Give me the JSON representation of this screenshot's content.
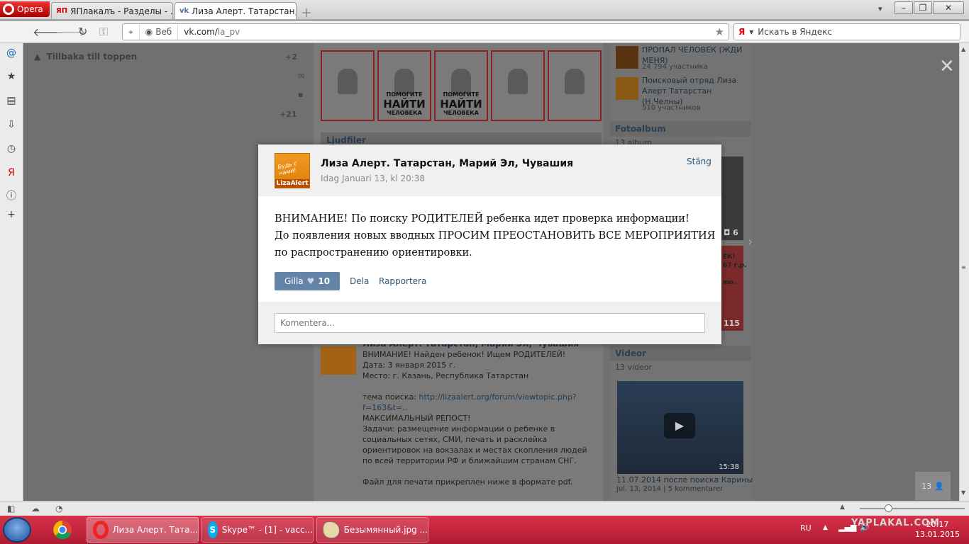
{
  "browser": {
    "name": "Opera",
    "tabs": [
      {
        "label": "ЯПлакалъ - Разделы - ...",
        "favicon": "ЯП",
        "active": false
      },
      {
        "label": "Лиза Алерт. Татарстан, ...",
        "favicon": "vk",
        "active": true
      }
    ],
    "address": {
      "mode_label": "Веб",
      "url_host": "vk.com/",
      "url_path": "la_pv"
    },
    "search": {
      "engine": "Я",
      "placeholder": "Искать в Яндекс"
    }
  },
  "page": {
    "back_to_top": "Tillbaka till toppen",
    "left_counts": {
      "friends": "+2",
      "other": "+21"
    },
    "posters": [
      {
        "help_line1": "",
        "help_line2": ""
      },
      {
        "help_line1": "ПОМОГИТЕ",
        "help_line2": "НАЙТИ"
      },
      {
        "help_line1": "ПОМОГИТЕ",
        "help_line2": "НАЙТИ"
      },
      {
        "help_line1": "",
        "help_line2": ""
      },
      {
        "help_line1": "",
        "help_line2": ""
      }
    ],
    "poster_help_bottom": "ЧЕЛОВЕКА",
    "audio_section": "Ljudfiler",
    "groups": [
      {
        "name": "ПРОПАЛ ЧЕЛОВЕК (ЖДИ МЕНЯ)",
        "members": "24 794 участника"
      },
      {
        "name": "Поисковый отряд Лиза Алерт Татарстан (Н.Челны)",
        "members": "510 участников"
      }
    ],
    "photo_album": {
      "title": "Fotoalbum",
      "count": "13 album",
      "photos_badge": "6",
      "album_badge": "115"
    },
    "poster_fragment": {
      "line1": "ЕК!",
      "line2": "67 г.р.",
      "line3": "ию."
    },
    "videos": {
      "title": "Videor",
      "count": "13 videor",
      "duration": "15:38",
      "caption": "11.07.2014 после поиска Карины",
      "meta_date": "Jul. 13, 2014",
      "meta_comments": "5 kommentarer"
    },
    "bg_post": {
      "author": "Лиза Алерт. Татарстан, Марий Эл, Чувашия",
      "lines": "ВНИМАНИЕ! Найден ребенок! Ищем РОДИТЕЛЕЙ!\nДата: 3 января 2015 г.\nМесто: г. Казань, Республика Татарстан\n\nтема поиска: ",
      "link": "http://lizaalert.org/forum/viewtopic.php?f=163&t=..",
      "rest": "\nМАКСИМАЛЬНЫЙ РЕПОСТ!\nЗадачи: размещение информации о ребенке в социальных сетях, СМИ, печать и расклейка ориентировок на вокзалах и местах скопления людей по всей территории РФ и ближайшим странам СНГ.\n\nФайл для печати прикреплен ниже в формате pdf."
    },
    "people_counter": "13"
  },
  "modal": {
    "logo_text": "LizaAlert",
    "logo_slogan": "Будь с нами!",
    "title": "Лиза Алерт. Татарстан, Марий Эл, Чувашия",
    "date": "Idag Januari 13, kl 20:38",
    "close_label": "Stäng",
    "body_line1": "ВНИМАНИЕ! По поиску РОДИТЕЛЕЙ ребенка идет проверка информации!",
    "body_line2": "До появления новых вводных ПРОСИМ ПРЕОСТАНОВИТЬ ВСЕ МЕРОПРИЯТИЯ",
    "body_line3": "по распространению ориентировки.",
    "like_label": "Gilla",
    "like_count": "10",
    "share_label": "Dela",
    "report_label": "Rapportera",
    "comment_placeholder": "Komentera..."
  },
  "taskbar": {
    "items": [
      {
        "label": "Лиза Алерт. Тата...",
        "icon": "opera-icon"
      },
      {
        "label": "Skype™ - [1] - vacc...",
        "icon": "skype-icon",
        "badge": "1"
      },
      {
        "label": "Безымянный.jpg ...",
        "icon": "paint-icon"
      }
    ],
    "lang": "RU",
    "watermark": "YAPLAKAL.COM",
    "time": "20:17",
    "date": "13.01.2015"
  },
  "colors": {
    "taskbar": "#c0243c",
    "vk_link": "#2b587a",
    "like_button": "#6383a8"
  }
}
